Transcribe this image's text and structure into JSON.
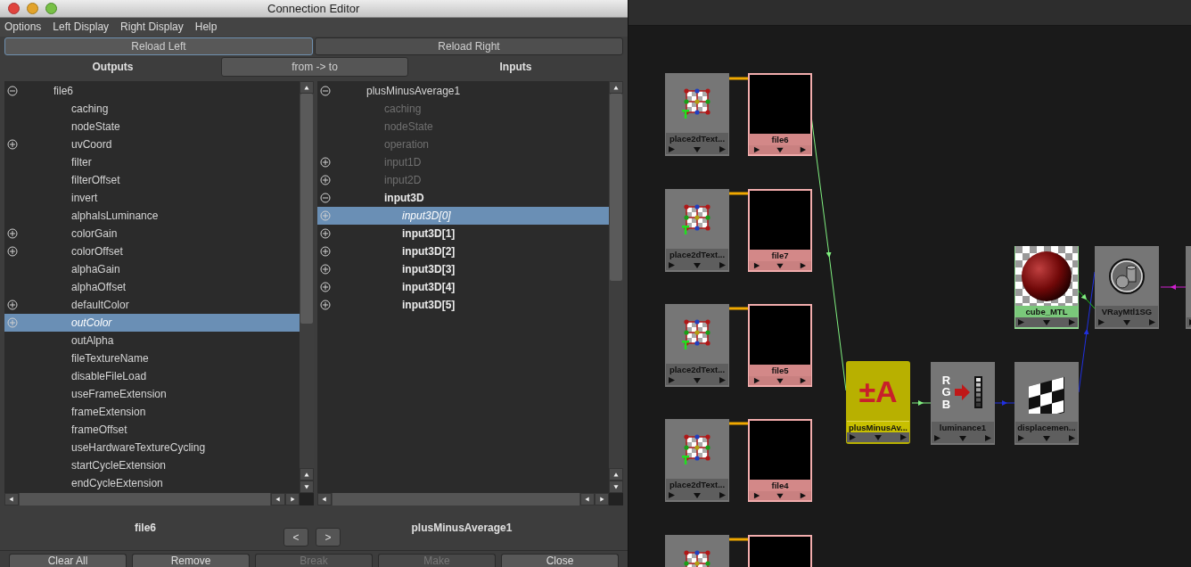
{
  "window": {
    "title": "Connection Editor"
  },
  "menu": [
    "Options",
    "Left Display",
    "Right Display",
    "Help"
  ],
  "reload_buttons": [
    {
      "label": "Reload Left",
      "focused": true
    },
    {
      "label": "Reload Right",
      "focused": false
    }
  ],
  "headers": {
    "left": "Outputs",
    "mode_button": "from -> to",
    "right": "Inputs"
  },
  "left_tree": [
    {
      "label": "file6",
      "expanded": true,
      "selected": false,
      "children": [
        {
          "label": "caching",
          "selected": false
        },
        {
          "label": "nodeState",
          "selected": false
        },
        {
          "label": "uvCoord",
          "expanded": false,
          "selected": false
        },
        {
          "label": "filter",
          "selected": false
        },
        {
          "label": "filterOffset",
          "selected": false
        },
        {
          "label": "invert",
          "selected": false
        },
        {
          "label": "alphaIsLuminance",
          "selected": false
        },
        {
          "label": "colorGain",
          "expanded": false,
          "selected": false
        },
        {
          "label": "colorOffset",
          "expanded": false,
          "selected": false
        },
        {
          "label": "alphaGain",
          "selected": false
        },
        {
          "label": "alphaOffset",
          "selected": false
        },
        {
          "label": "defaultColor",
          "expanded": false,
          "selected": false
        },
        {
          "label": "outColor",
          "expanded": false,
          "selected": true
        },
        {
          "label": "outAlpha",
          "selected": false
        },
        {
          "label": "fileTextureName",
          "selected": false
        },
        {
          "label": "disableFileLoad",
          "selected": false
        },
        {
          "label": "useFrameExtension",
          "selected": false
        },
        {
          "label": "frameExtension",
          "selected": false
        },
        {
          "label": "frameOffset",
          "selected": false
        },
        {
          "label": "useHardwareTextureCycling",
          "selected": false
        },
        {
          "label": "startCycleExtension",
          "selected": false
        },
        {
          "label": "endCycleExtension",
          "selected": false
        }
      ]
    }
  ],
  "right_tree": [
    {
      "label": "plusMinusAverage1",
      "expanded": true,
      "selected": false,
      "disabled": false,
      "connected": false,
      "children": [
        {
          "label": "caching",
          "selected": false,
          "disabled": true,
          "connected": false
        },
        {
          "label": "nodeState",
          "selected": false,
          "disabled": true,
          "connected": false
        },
        {
          "label": "operation",
          "selected": false,
          "disabled": true,
          "connected": false
        },
        {
          "label": "input1D",
          "expanded": false,
          "selected": false,
          "disabled": true,
          "connected": false
        },
        {
          "label": "input2D",
          "expanded": false,
          "selected": false,
          "disabled": true,
          "connected": false
        },
        {
          "label": "input3D",
          "expanded": true,
          "selected": false,
          "disabled": false,
          "connected": true,
          "children": [
            {
              "label": "input3D[0]",
              "expanded": false,
              "selected": true,
              "disabled": false,
              "connected": false
            },
            {
              "label": "input3D[1]",
              "expanded": false,
              "selected": false,
              "disabled": false,
              "connected": true
            },
            {
              "label": "input3D[2]",
              "expanded": false,
              "selected": false,
              "disabled": false,
              "connected": true
            },
            {
              "label": "input3D[3]",
              "expanded": false,
              "selected": false,
              "disabled": false,
              "connected": true
            },
            {
              "label": "input3D[4]",
              "expanded": false,
              "selected": false,
              "disabled": false,
              "connected": true
            },
            {
              "label": "input3D[5]",
              "expanded": false,
              "selected": false,
              "disabled": false,
              "connected": true
            }
          ]
        }
      ]
    }
  ],
  "footer": {
    "left_node": "file6",
    "right_node": "plusMinusAverage1",
    "nav": [
      "<",
      ">"
    ]
  },
  "buttons": [
    {
      "label": "Clear All",
      "disabled": false
    },
    {
      "label": "Remove",
      "disabled": false
    },
    {
      "label": "Break",
      "disabled": true
    },
    {
      "label": "Make",
      "disabled": true
    },
    {
      "label": "Close",
      "disabled": false
    }
  ],
  "graph_nodes": [
    {
      "kind": "place2d",
      "label": "place2dText...",
      "selected": false
    },
    {
      "kind": "file",
      "label": "file6",
      "selected": false
    },
    {
      "kind": "place2d",
      "label": "place2dText...",
      "selected": false
    },
    {
      "kind": "file",
      "label": "file7",
      "selected": false
    },
    {
      "kind": "material",
      "label": "cube_MTL",
      "selected": false
    },
    {
      "kind": "shadinggroup",
      "label": "VRayMtl1SG",
      "selected": false
    },
    {
      "kind": "partial",
      "selected": false
    },
    {
      "kind": "place2d",
      "label": "place2dText...",
      "selected": false
    },
    {
      "kind": "file",
      "label": "file5",
      "selected": false
    },
    {
      "kind": "plusminus",
      "label": "plusMinusAv...",
      "icon_text": "±A",
      "selected": true
    },
    {
      "kind": "luminance",
      "label": "luminance1",
      "icon_text": "RGB",
      "selected": false
    },
    {
      "kind": "displacement",
      "label": "displacemen...",
      "selected": false
    },
    {
      "kind": "place2d",
      "label": "place2dText...",
      "selected": false
    },
    {
      "kind": "file",
      "label": "file4",
      "selected": false
    },
    {
      "kind": "place2d",
      "selected": false
    },
    {
      "kind": "file",
      "selected": false
    }
  ]
}
